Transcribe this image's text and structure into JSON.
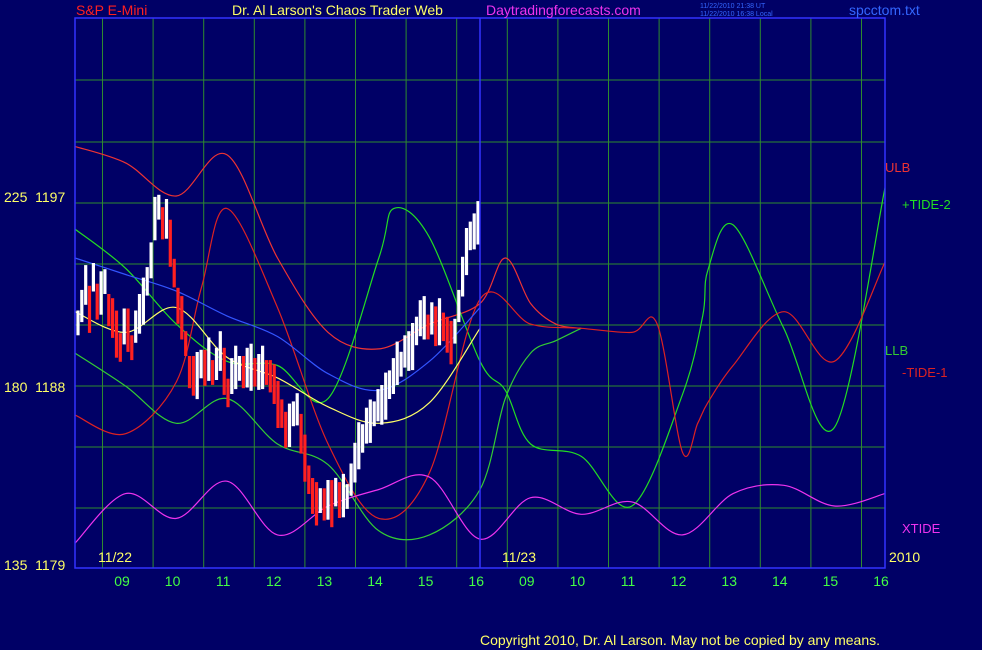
{
  "header": {
    "symbol": "S&P E-Mini",
    "title": "Dr. Al Larson's Chaos Trader Web",
    "site": "Daytradingforecasts.com",
    "timestamp_ut": "11/22/2010 21:38 UT",
    "timestamp_local": "11/22/2010 16:38 Local",
    "filename": "spcctom.txt"
  },
  "footer": {
    "copyright": "Copyright 2010, Dr. Al Larson. May not be copied by any means."
  },
  "colors": {
    "background": "#000066",
    "grid": "#2e8b2e",
    "frame": "#3333ff",
    "price_up": "#ffffff",
    "price_down": "#ff2020",
    "ulb": "#ee3333",
    "llb": "#33cc33",
    "tide_plus": "#22dd22",
    "tide_minus": "#dd2222",
    "xtide": "#ee33ee",
    "ma_fast": "#ffff66",
    "ma_slow": "#3355ff",
    "time_labels": "#44ff44",
    "price_labels": "#ffff66"
  },
  "chart_data": {
    "type": "line",
    "title": "S&P E-Mini",
    "y_axis": {
      "labels": [
        {
          "value": 1197,
          "text": "225  1197"
        },
        {
          "value": 1188,
          "text": "180  1188"
        },
        {
          "value": 1179,
          "text": "135  1179"
        }
      ],
      "ylim": [
        1179,
        1197
      ],
      "unit": "points"
    },
    "x_axis": {
      "day1_label": "11/22",
      "day2_label": "11/23",
      "year_label": "2010",
      "tick_labels": [
        "09",
        "10",
        "11",
        "12",
        "13",
        "14",
        "15",
        "16",
        "09",
        "10",
        "11",
        "12",
        "13",
        "14",
        "15",
        "16"
      ],
      "xlim_day_hours": [
        8.0,
        24.0
      ]
    },
    "grid": true,
    "series_labels": [
      {
        "key": "ulb",
        "text": "ULB"
      },
      {
        "key": "tide_plus",
        "text": "+TIDE-2"
      },
      {
        "key": "llb",
        "text": "LLB"
      },
      {
        "key": "tide_minus",
        "text": "-TIDE-1"
      },
      {
        "key": "xtide",
        "text": "XTIDE"
      }
    ],
    "price_bars": [
      1190.8,
      1191.6,
      1192.6,
      1191.4,
      1193.0,
      1191.8,
      1192.2,
      1192.8,
      1191.4,
      1191.0,
      1190.2,
      1189.6,
      1190.6,
      1190.4,
      1189.6,
      1190.6,
      1191.2,
      1191.8,
      1192.8,
      1193.8,
      1195.8,
      1196.4,
      1195.6,
      1195.8,
      1194.6,
      1193.2,
      1191.6,
      1191.0,
      1189.8,
      1188.4,
      1188.2,
      1188.2,
      1188.8,
      1188.6,
      1189.0,
      1188.4,
      1188.8,
      1189.4,
      1188.4,
      1187.4,
      1188.2,
      1188.6,
      1188.6,
      1188.4,
      1188.6,
      1188.6,
      1188.4,
      1188.4,
      1188.6,
      1188.4,
      1188.2,
      1187.8,
      1186.8,
      1186.4,
      1185.6,
      1185.8,
      1186.4,
      1186.6,
      1185.4,
      1184.2,
      1183.2,
      1182.4,
      1182.0,
      1182.2,
      1182.0,
      1182.2,
      1182.0,
      1182.6,
      1182.2,
      1182.4,
      1182.4,
      1183.2,
      1184.0,
      1184.8,
      1185.2,
      1185.8,
      1186.0,
      1186.4,
      1186.8,
      1186.8,
      1187.2,
      1187.8,
      1188.2,
      1188.8,
      1188.8,
      1189.4,
      1189.4,
      1189.6,
      1190.4,
      1191.0,
      1191.0,
      1190.6,
      1191.0,
      1190.6,
      1190.8,
      1190.6,
      1190.2,
      1189.8,
      1190.4,
      1191.6,
      1193.0,
      1194.2,
      1195.0,
      1195.2,
      1195.6
    ],
    "series": [
      {
        "key": "ulb",
        "x": [
          8.0,
          9.0,
          10.0,
          11.0,
          12.0,
          13.0,
          14.0,
          15.0,
          16.0,
          16.5,
          17.0,
          17.5,
          18.0
        ],
        "y": [
          1199.4,
          1198.6,
          1197.0,
          1199.0,
          1194.0,
          1190.4,
          1189.6,
          1190.8,
          1191.8,
          1194.0,
          1191.8,
          1190.8,
          1190.6
        ]
      },
      {
        "key": "llb",
        "x": [
          8.0,
          9.0,
          10.0,
          11.0,
          12.0,
          13.0,
          14.0,
          15.0,
          16.0,
          16.5,
          17.0,
          17.5,
          18.0
        ],
        "y": [
          1189.4,
          1187.8,
          1186.0,
          1187.2,
          1185.0,
          1184.0,
          1180.8,
          1180.6,
          1182.8,
          1187.2,
          1189.4,
          1190.0,
          1190.6
        ]
      },
      {
        "key": "tide_plus",
        "x": [
          8.0,
          9.0,
          10.0,
          11.0,
          12.0,
          13.0,
          14.0,
          14.3,
          15.0,
          16.0,
          16.5,
          17.0,
          18.0,
          19.0,
          20.0,
          20.4,
          20.5,
          21.0,
          22.0,
          23.0,
          24.0
        ],
        "y": [
          1195.4,
          1193.5,
          1190.8,
          1189.0,
          1188.8,
          1187.2,
          1194.0,
          1196.4,
          1195.0,
          1189.0,
          1187.6,
          1185.0,
          1184.4,
          1182.0,
          1187.4,
          1191.2,
          1193.4,
          1195.6,
          1190.6,
          1185.8,
          1197.4
        ]
      },
      {
        "key": "tide_minus",
        "x": [
          8.0,
          9.0,
          10.0,
          10.5,
          11.0,
          12.0,
          13.0,
          14.0,
          15.0,
          16.0,
          17.0,
          18.0,
          19.0,
          19.5,
          20.0,
          20.3,
          20.5,
          21.0,
          22.0,
          23.0,
          24.0
        ],
        "y": [
          1186.4,
          1185.5,
          1188.0,
          1192.6,
          1196.4,
          1191.6,
          1185.0,
          1181.4,
          1183.6,
          1192.0,
          1190.8,
          1190.6,
          1190.4,
          1190.8,
          1184.6,
          1186.0,
          1187.0,
          1188.8,
          1191.4,
          1189.0,
          1193.8
        ]
      },
      {
        "key": "ma_fast",
        "x": [
          8.0,
          9.0,
          10.0,
          11.0,
          12.0,
          13.0,
          14.0,
          15.0,
          16.0
        ],
        "y": [
          1191.4,
          1190.4,
          1191.6,
          1189.2,
          1188.2,
          1186.8,
          1186.0,
          1187.0,
          1190.6
        ]
      },
      {
        "key": "ma_slow",
        "x": [
          8.0,
          9.0,
          10.0,
          11.0,
          12.0,
          13.0,
          14.0,
          15.0,
          16.0
        ],
        "y": [
          1194.0,
          1193.2,
          1192.4,
          1191.2,
          1190.2,
          1188.4,
          1187.6,
          1189.0,
          1191.6
        ]
      },
      {
        "key": "xtide",
        "x": [
          8.0,
          9.0,
          10.0,
          11.0,
          12.0,
          13.0,
          14.0,
          15.0,
          16.0,
          17.0,
          18.0,
          19.0,
          20.0,
          21.0,
          22.0,
          23.0,
          24.0
        ],
        "y": [
          1180.2,
          1182.6,
          1181.4,
          1183.2,
          1180.6,
          1182.0,
          1182.8,
          1183.4,
          1180.4,
          1182.4,
          1181.6,
          1182.2,
          1180.6,
          1182.6,
          1183.0,
          1182.0,
          1182.6
        ]
      }
    ]
  }
}
